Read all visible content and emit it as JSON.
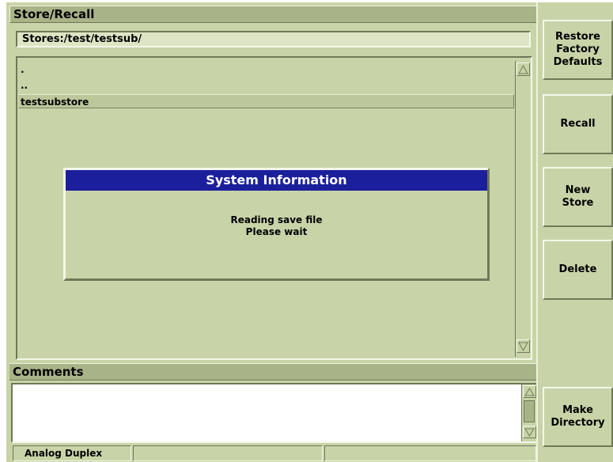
{
  "window": {
    "title": "Store/Recall"
  },
  "path": {
    "value": "Stores:/test/testsub/"
  },
  "file_list": {
    "items": [
      {
        "label": "."
      },
      {
        "label": ".."
      },
      {
        "label": "testsubstore",
        "selected": true
      }
    ]
  },
  "dialog": {
    "title": "System Information",
    "line1": "Reading save file",
    "line2": "Please wait"
  },
  "comments": {
    "title": "Comments",
    "value": ""
  },
  "status_bar": {
    "mode": "Analog Duplex"
  },
  "softkeys": {
    "restore": "Restore\nFactory\nDefaults",
    "recall": "Recall",
    "new_store": "New\nStore",
    "delete": "Delete",
    "make_directory": "Make\nDirectory"
  },
  "colors": {
    "panel": "#c8d4a8",
    "title_bar": "#a9b388",
    "dialog_title": "#1b1f9c"
  }
}
